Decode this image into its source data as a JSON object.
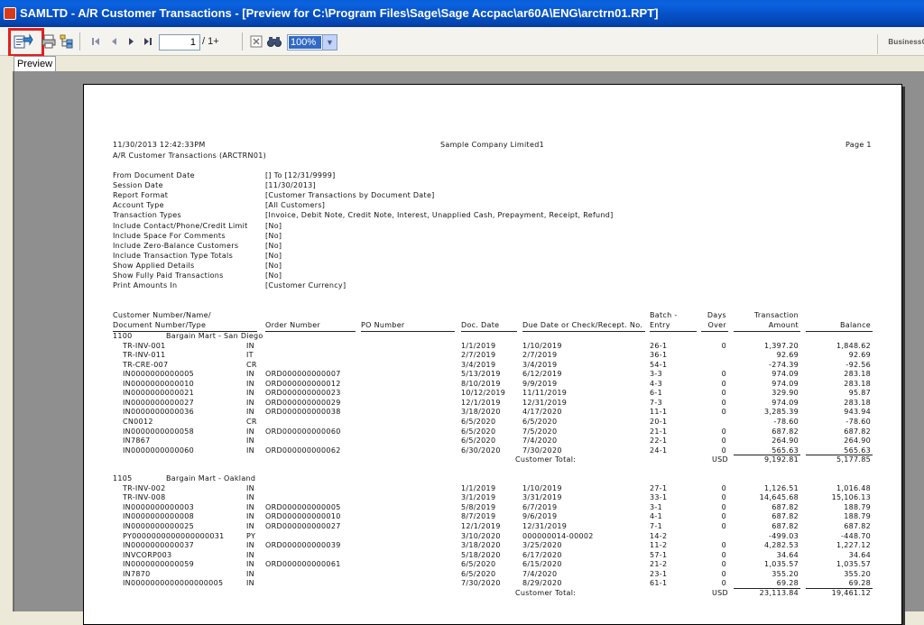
{
  "window": {
    "title": "SAMLTD - A/R Customer Transactions - [Preview for C:\\Program Files\\Sage\\Sage Accpac\\ar60A\\ENG\\arctrn01.RPT]"
  },
  "toolbar": {
    "page_current": "1",
    "page_total": "/ 1+",
    "zoom": "100%",
    "brand": "BusinessO"
  },
  "tab": {
    "label": "Preview"
  },
  "report": {
    "date_time": "11/30/2013  12:42:33PM",
    "company": "Sample Company Limited1",
    "page": "Page 1",
    "title": "A/R Customer Transactions (ARCTRN01)",
    "criteria": [
      {
        "label": "From Document Date",
        "value": "[]  To  [12/31/9999]"
      },
      {
        "label": "Session Date",
        "value": "[11/30/2013]"
      },
      {
        "label": "Report Format",
        "value": "[Customer Transactions by Document Date]"
      },
      {
        "label": "Account Type",
        "value": "[All Customers]"
      },
      {
        "label": "Transaction Types",
        "value": "[Invoice, Debit Note, Credit Note, Interest, Unapplied Cash, Prepayment, Receipt, Refund]"
      },
      {
        "label": "Include Contact/Phone/Credit Limit",
        "value": "[No]"
      },
      {
        "label": "Include Space For Comments",
        "value": "[No]"
      },
      {
        "label": "Include Zero-Balance Customers",
        "value": "[No]"
      },
      {
        "label": "Include Transaction Type Totals",
        "value": "[No]"
      },
      {
        "label": "Show Applied Details",
        "value": "[No]"
      },
      {
        "label": "Show Fully Paid Transactions",
        "value": "[No]"
      },
      {
        "label": "Print Amounts In",
        "value": "[Customer Currency]"
      }
    ],
    "columns": {
      "cust_line1": "Customer Number/Name/",
      "cust_line2": "Document Number/Type",
      "order": "Order Number",
      "po": "PO Number",
      "doc_date": "Doc. Date",
      "due": "Due Date or Check/Recept. No.",
      "batch1": "Batch -",
      "batch2": "Entry",
      "days1": "Days",
      "days2": "Over",
      "amt1": "Transaction",
      "amt2": "Amount",
      "balance": "Balance"
    },
    "customers": [
      {
        "number": "1100",
        "name": "Bargain Mart - San Diego",
        "total_label": "Customer Total:",
        "currency": "USD",
        "total_amount": "9,192.81",
        "total_balance": "5,177.85",
        "rows": [
          {
            "doc": "TR-INV-001",
            "type": "IN",
            "order": "",
            "date": "1/1/2019",
            "due": "1/10/2019",
            "batch": "26-1",
            "days": "0",
            "amount": "1,397.20",
            "balance": "1,848.62"
          },
          {
            "doc": "TR-INV-011",
            "type": "IT",
            "order": "",
            "date": "2/7/2019",
            "due": "2/7/2019",
            "batch": "36-1",
            "days": "",
            "amount": "92.69",
            "balance": "92.69"
          },
          {
            "doc": "TR-CRE-007",
            "type": "CR",
            "order": "",
            "date": "3/4/2019",
            "due": "3/4/2019",
            "batch": "54-1",
            "days": "",
            "amount": "-274.39",
            "balance": "-92.56"
          },
          {
            "doc": "IN0000000000005",
            "type": "IN",
            "order": "ORD000000000007",
            "date": "5/13/2019",
            "due": "6/12/2019",
            "batch": "3-3",
            "days": "0",
            "amount": "974.09",
            "balance": "283.18"
          },
          {
            "doc": "IN0000000000010",
            "type": "IN",
            "order": "ORD000000000012",
            "date": "8/10/2019",
            "due": "9/9/2019",
            "batch": "4-3",
            "days": "0",
            "amount": "974.09",
            "balance": "283.18"
          },
          {
            "doc": "IN0000000000021",
            "type": "IN",
            "order": "ORD000000000023",
            "date": "10/12/2019",
            "due": "11/11/2019",
            "batch": "6-1",
            "days": "0",
            "amount": "329.90",
            "balance": "95.87"
          },
          {
            "doc": "IN0000000000027",
            "type": "IN",
            "order": "ORD000000000029",
            "date": "12/1/2019",
            "due": "12/31/2019",
            "batch": "7-3",
            "days": "0",
            "amount": "974.09",
            "balance": "283.18"
          },
          {
            "doc": "IN0000000000036",
            "type": "IN",
            "order": "ORD000000000038",
            "date": "3/18/2020",
            "due": "4/17/2020",
            "batch": "11-1",
            "days": "0",
            "amount": "3,285.39",
            "balance": "943.94"
          },
          {
            "doc": "CN0012",
            "type": "CR",
            "order": "",
            "date": "6/5/2020",
            "due": "6/5/2020",
            "batch": "20-1",
            "days": "",
            "amount": "-78.60",
            "balance": "-78.60"
          },
          {
            "doc": "IN0000000000058",
            "type": "IN",
            "order": "ORD000000000060",
            "date": "6/5/2020",
            "due": "7/5/2020",
            "batch": "21-1",
            "days": "0",
            "amount": "687.82",
            "balance": "687.82"
          },
          {
            "doc": "IN7867",
            "type": "IN",
            "order": "",
            "date": "6/5/2020",
            "due": "7/4/2020",
            "batch": "22-1",
            "days": "0",
            "amount": "264.90",
            "balance": "264.90"
          },
          {
            "doc": "IN0000000000060",
            "type": "IN",
            "order": "ORD000000000062",
            "date": "6/30/2020",
            "due": "7/30/2020",
            "batch": "24-1",
            "days": "0",
            "amount": "565.63",
            "balance": "565.63"
          }
        ]
      },
      {
        "number": "1105",
        "name": "Bargain Mart - Oakland",
        "total_label": "Customer Total:",
        "currency": "USD",
        "total_amount": "23,113.84",
        "total_balance": "19,461.12",
        "rows": [
          {
            "doc": "TR-INV-002",
            "type": "IN",
            "order": "",
            "date": "1/1/2019",
            "due": "1/10/2019",
            "batch": "27-1",
            "days": "0",
            "amount": "1,126.51",
            "balance": "1,016.48"
          },
          {
            "doc": "TR-INV-008",
            "type": "IN",
            "order": "",
            "date": "3/1/2019",
            "due": "3/31/2019",
            "batch": "33-1",
            "days": "0",
            "amount": "14,645.68",
            "balance": "15,106.13"
          },
          {
            "doc": "IN0000000000003",
            "type": "IN",
            "order": "ORD000000000005",
            "date": "5/8/2019",
            "due": "6/7/2019",
            "batch": "3-1",
            "days": "0",
            "amount": "687.82",
            "balance": "188.79"
          },
          {
            "doc": "IN0000000000008",
            "type": "IN",
            "order": "ORD000000000010",
            "date": "8/7/2019",
            "due": "9/6/2019",
            "batch": "4-1",
            "days": "0",
            "amount": "687.82",
            "balance": "188.79"
          },
          {
            "doc": "IN0000000000025",
            "type": "IN",
            "order": "ORD000000000027",
            "date": "12/1/2019",
            "due": "12/31/2019",
            "batch": "7-1",
            "days": "0",
            "amount": "687.82",
            "balance": "687.82"
          },
          {
            "doc": "PY0000000000000000031",
            "type": "PY",
            "order": "",
            "date": "3/10/2020",
            "due": "000000014-00002",
            "batch": "14-2",
            "days": "",
            "amount": "-499.03",
            "balance": "-448.70"
          },
          {
            "doc": "IN0000000000037",
            "type": "IN",
            "order": "ORD000000000039",
            "date": "3/18/2020",
            "due": "3/25/2020",
            "batch": "11-2",
            "days": "0",
            "amount": "4,282.53",
            "balance": "1,227.12"
          },
          {
            "doc": "INVCORP003",
            "type": "IN",
            "order": "",
            "date": "5/18/2020",
            "due": "6/17/2020",
            "batch": "57-1",
            "days": "0",
            "amount": "34.64",
            "balance": "34.64"
          },
          {
            "doc": "IN0000000000059",
            "type": "IN",
            "order": "ORD000000000061",
            "date": "6/5/2020",
            "due": "6/15/2020",
            "batch": "21-2",
            "days": "0",
            "amount": "1,035.57",
            "balance": "1,035.57"
          },
          {
            "doc": "IN7870",
            "type": "IN",
            "order": "",
            "date": "6/5/2020",
            "due": "7/4/2020",
            "batch": "23-1",
            "days": "0",
            "amount": "355.20",
            "balance": "355.20"
          },
          {
            "doc": "IN0000000000000000005",
            "type": "IN",
            "order": "",
            "date": "7/30/2020",
            "due": "8/29/2020",
            "batch": "61-1",
            "days": "0",
            "amount": "69.28",
            "balance": "69.28"
          }
        ]
      }
    ]
  }
}
